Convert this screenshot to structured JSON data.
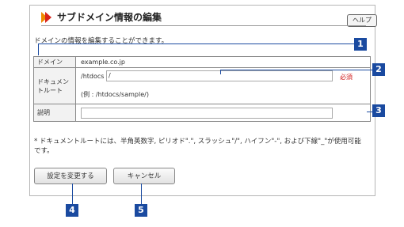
{
  "title": "サブドメイン情報の編集",
  "help_label": "ヘルプ",
  "description": "ドメインの情報を編集することができます。",
  "rows": {
    "domain": {
      "label": "ドメイン",
      "value": "example.co.jp"
    },
    "docroot": {
      "label_line1": "ドキュメン",
      "label_line2": "トルート",
      "prefix": "/htdocs",
      "input_value": "/",
      "required": "必須",
      "example": "(例 : /htdocs/sample/)"
    },
    "memo": {
      "label": "説明",
      "input_value": ""
    }
  },
  "note_line1": "* ドキュメントルートには、半角英数字, ピリオド\".\", スラッシュ\"/\", ハイフン\"-\", および下線\"_\"が使用可能",
  "note_line2": "です。",
  "buttons": {
    "save": "設定を変更する",
    "cancel": "キャンセル"
  },
  "callouts": [
    "1",
    "2",
    "3",
    "4",
    "5"
  ],
  "colors": {
    "callout": "#1a4aa0",
    "required": "#d01a1a",
    "accent_orange": "#f08a00",
    "accent_red": "#d8221a"
  }
}
